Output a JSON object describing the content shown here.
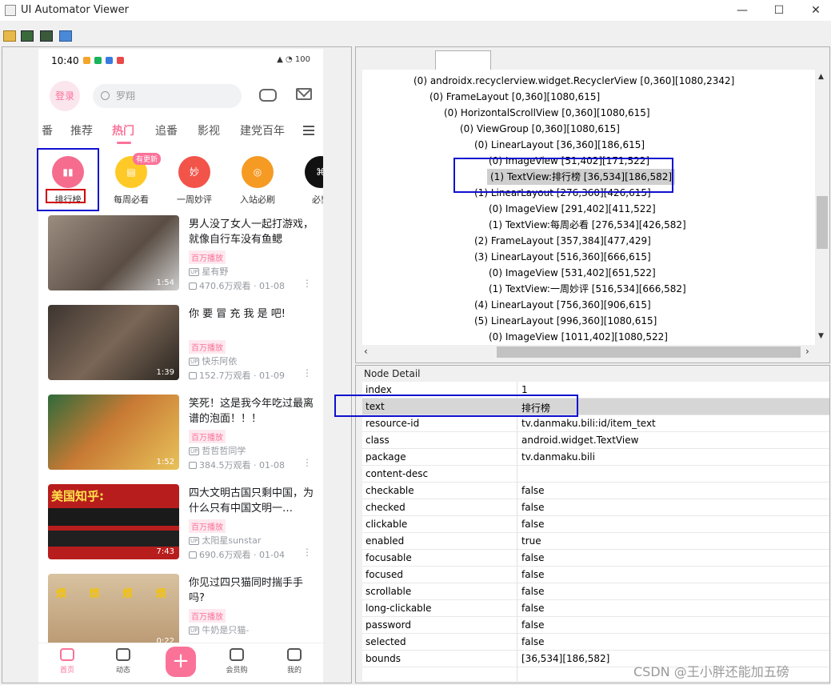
{
  "window": {
    "title": "UI Automator Viewer",
    "min": "—",
    "max": "☐",
    "close": "✕"
  },
  "toolbar": {
    "icons": [
      "open-folder-icon",
      "device-screenshot-icon",
      "device-screenshot-compressed-icon",
      "save-icon"
    ]
  },
  "phone": {
    "time": "10:40",
    "status_right": "▲ ◔ 100",
    "login": "登录",
    "search_placeholder": "罗翔",
    "tabs": [
      "番",
      "推荐",
      "热门",
      "追番",
      "影视",
      "建党百年"
    ],
    "active_tab": "热门",
    "categories": [
      {
        "label": "排行榜",
        "color": "#f56c8e",
        "glyph": "▮▮"
      },
      {
        "label": "每周必看",
        "color": "#ffca28",
        "glyph": "▤"
      },
      {
        "label": "一周妙评",
        "color": "#f2544a",
        "glyph": "妙"
      },
      {
        "label": "入站必刷",
        "color": "#f59a23",
        "glyph": "◎"
      },
      {
        "label": "必剪",
        "color": "#111111",
        "glyph": "⌘"
      }
    ],
    "new_badge": "有更新",
    "videos": [
      {
        "title": "男人没了女人一起打游戏，就像自行车没有鱼鳃",
        "badge": "百万播放",
        "up": "星有野",
        "views": "470.6万观看 · 01-08",
        "duration": "1:54",
        "thumb_color": "#8a7f74"
      },
      {
        "title": "你 要 冒 充 我 是 吧!",
        "badge": "百万播放",
        "up": "快乐阿依",
        "views": "152.7万观看 · 01-09",
        "duration": "1:39",
        "thumb_color": "#6b5a4e"
      },
      {
        "title": "笑死！这是我今年吃过最离谱的泡面！！！",
        "badge": "百万播放",
        "up": "哲哲哲同学",
        "views": "384.5万观看 · 01-08",
        "duration": "1:52",
        "thumb_color": "#b86a2a"
      },
      {
        "title": "四大文明古国只剩中国，为什么只有中国文明一…",
        "badge": "百万播放",
        "up": "太阳星sunstar",
        "views": "690.6万观看 · 01-04",
        "duration": "7:43",
        "thumb_color": "#c12222"
      },
      {
        "title": "你见过四只猫同时揣手手吗?",
        "badge": "百万播放",
        "up": "牛奶是只猫-",
        "views": "",
        "duration": "0:22",
        "thumb_color": "#c9a67a"
      }
    ],
    "thumb_text_3": "美国知乎:",
    "thumb_text_4": "烦 烦 烦 烦",
    "bottom_nav": {
      "home": "首页",
      "dynamic": "动态",
      "vip": "会员购",
      "mine": "我的",
      "plus": "+"
    }
  },
  "tree": {
    "rows": [
      {
        "text": "(0) androidx.recyclerview.widget.RecyclerView [0,360][1080,2342]",
        "selected": false
      },
      {
        "text": "(0) FrameLayout [0,360][1080,615]",
        "selected": false
      },
      {
        "text": "(0) HorizontalScrollView [0,360][1080,615]",
        "selected": false
      },
      {
        "text": "(0) ViewGroup [0,360][1080,615]",
        "selected": false
      },
      {
        "text": "(0) LinearLayout [36,360][186,615]",
        "selected": false
      },
      {
        "text": "(0) ImageView [51,402][171,522]",
        "selected": false
      },
      {
        "text": "(1) TextView:排行榜 [36,534][186,582]",
        "selected": true
      },
      {
        "text": "(1) LinearLayout [276,360][426,615]",
        "selected": false
      },
      {
        "text": "(0) ImageView [291,402][411,522]",
        "selected": false
      },
      {
        "text": "(1) TextView:每周必看 [276,534][426,582]",
        "selected": false
      },
      {
        "text": "(2) FrameLayout [357,384][477,429]",
        "selected": false
      },
      {
        "text": "(3) LinearLayout [516,360][666,615]",
        "selected": false
      },
      {
        "text": "(0) ImageView [531,402][651,522]",
        "selected": false
      },
      {
        "text": "(1) TextView:一周妙评 [516,534][666,582]",
        "selected": false
      },
      {
        "text": "(4) LinearLayout [756,360][906,615]",
        "selected": false
      },
      {
        "text": "(5) LinearLayout [996,360][1080,615]",
        "selected": false
      },
      {
        "text": "(0) ImageView [1011,402][1080,522]",
        "selected": false
      }
    ]
  },
  "node_detail": {
    "title": "Node Detail",
    "rows": [
      {
        "key": "index",
        "value": "1"
      },
      {
        "key": "text",
        "value": "排行榜"
      },
      {
        "key": "resource-id",
        "value": "tv.danmaku.bili:id/item_text"
      },
      {
        "key": "class",
        "value": "android.widget.TextView"
      },
      {
        "key": "package",
        "value": "tv.danmaku.bili"
      },
      {
        "key": "content-desc",
        "value": ""
      },
      {
        "key": "checkable",
        "value": "false"
      },
      {
        "key": "checked",
        "value": "false"
      },
      {
        "key": "clickable",
        "value": "false"
      },
      {
        "key": "enabled",
        "value": "true"
      },
      {
        "key": "focusable",
        "value": "false"
      },
      {
        "key": "focused",
        "value": "false"
      },
      {
        "key": "scrollable",
        "value": "false"
      },
      {
        "key": "long-clickable",
        "value": "false"
      },
      {
        "key": "password",
        "value": "false"
      },
      {
        "key": "selected",
        "value": "false"
      },
      {
        "key": "bounds",
        "value": "[36,534][186,582]"
      }
    ]
  },
  "watermark": "CSDN @王小胖还能加五磅"
}
